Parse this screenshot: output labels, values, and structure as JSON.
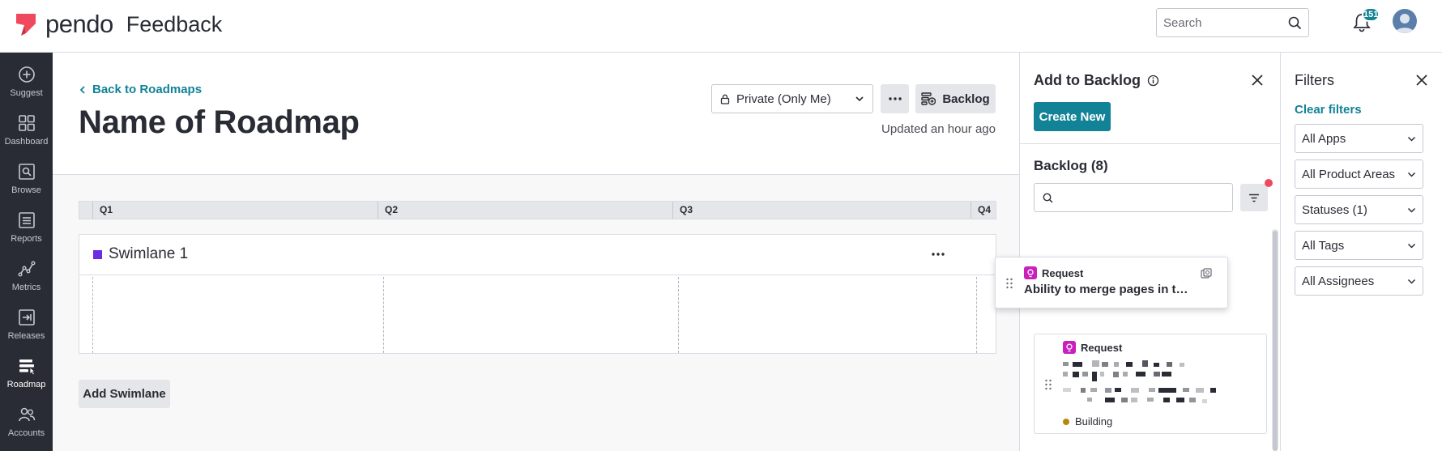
{
  "header": {
    "logo_text": "pendo",
    "product_name": "Feedback",
    "search_placeholder": "Search",
    "notification_count": "151",
    "brand_color": "#f0485c",
    "accent_color": "#128297"
  },
  "nav": {
    "items": [
      {
        "label": "Suggest",
        "icon": "plus-circle-icon"
      },
      {
        "label": "Dashboard",
        "icon": "grid-icon"
      },
      {
        "label": "Browse",
        "icon": "browse-icon"
      },
      {
        "label": "Reports",
        "icon": "list-icon"
      },
      {
        "label": "Metrics",
        "icon": "metrics-icon"
      },
      {
        "label": "Releases",
        "icon": "releases-icon"
      },
      {
        "label": "Roadmap",
        "icon": "roadmap-icon",
        "active": true
      },
      {
        "label": "Accounts",
        "icon": "people-icon"
      }
    ]
  },
  "main": {
    "back_link": "Back to Roadmaps",
    "title": "Name of Roadmap",
    "privacy": "Private (Only Me)",
    "backlog_button": "Backlog",
    "updated": "Updated an hour ago",
    "quarters": [
      "Q1",
      "Q2",
      "Q3",
      "Q4"
    ],
    "swimlane": {
      "title": "Swimlane 1",
      "color": "#6b2ce5"
    },
    "add_swimlane": "Add Swimlane"
  },
  "backlog_panel": {
    "title": "Add to Backlog",
    "create_new": "Create New",
    "backlog_title": "Backlog (8)",
    "search_value": "",
    "drag_card": {
      "type": "Request",
      "title": "Ability to merge pages in the..."
    },
    "list_card": {
      "type": "Request",
      "status": "Building"
    }
  },
  "filters_panel": {
    "title": "Filters",
    "clear": "Clear filters",
    "selects": [
      "All Apps",
      "All Product Areas",
      "Statuses (1)",
      "All Tags",
      "All Assignees"
    ]
  }
}
